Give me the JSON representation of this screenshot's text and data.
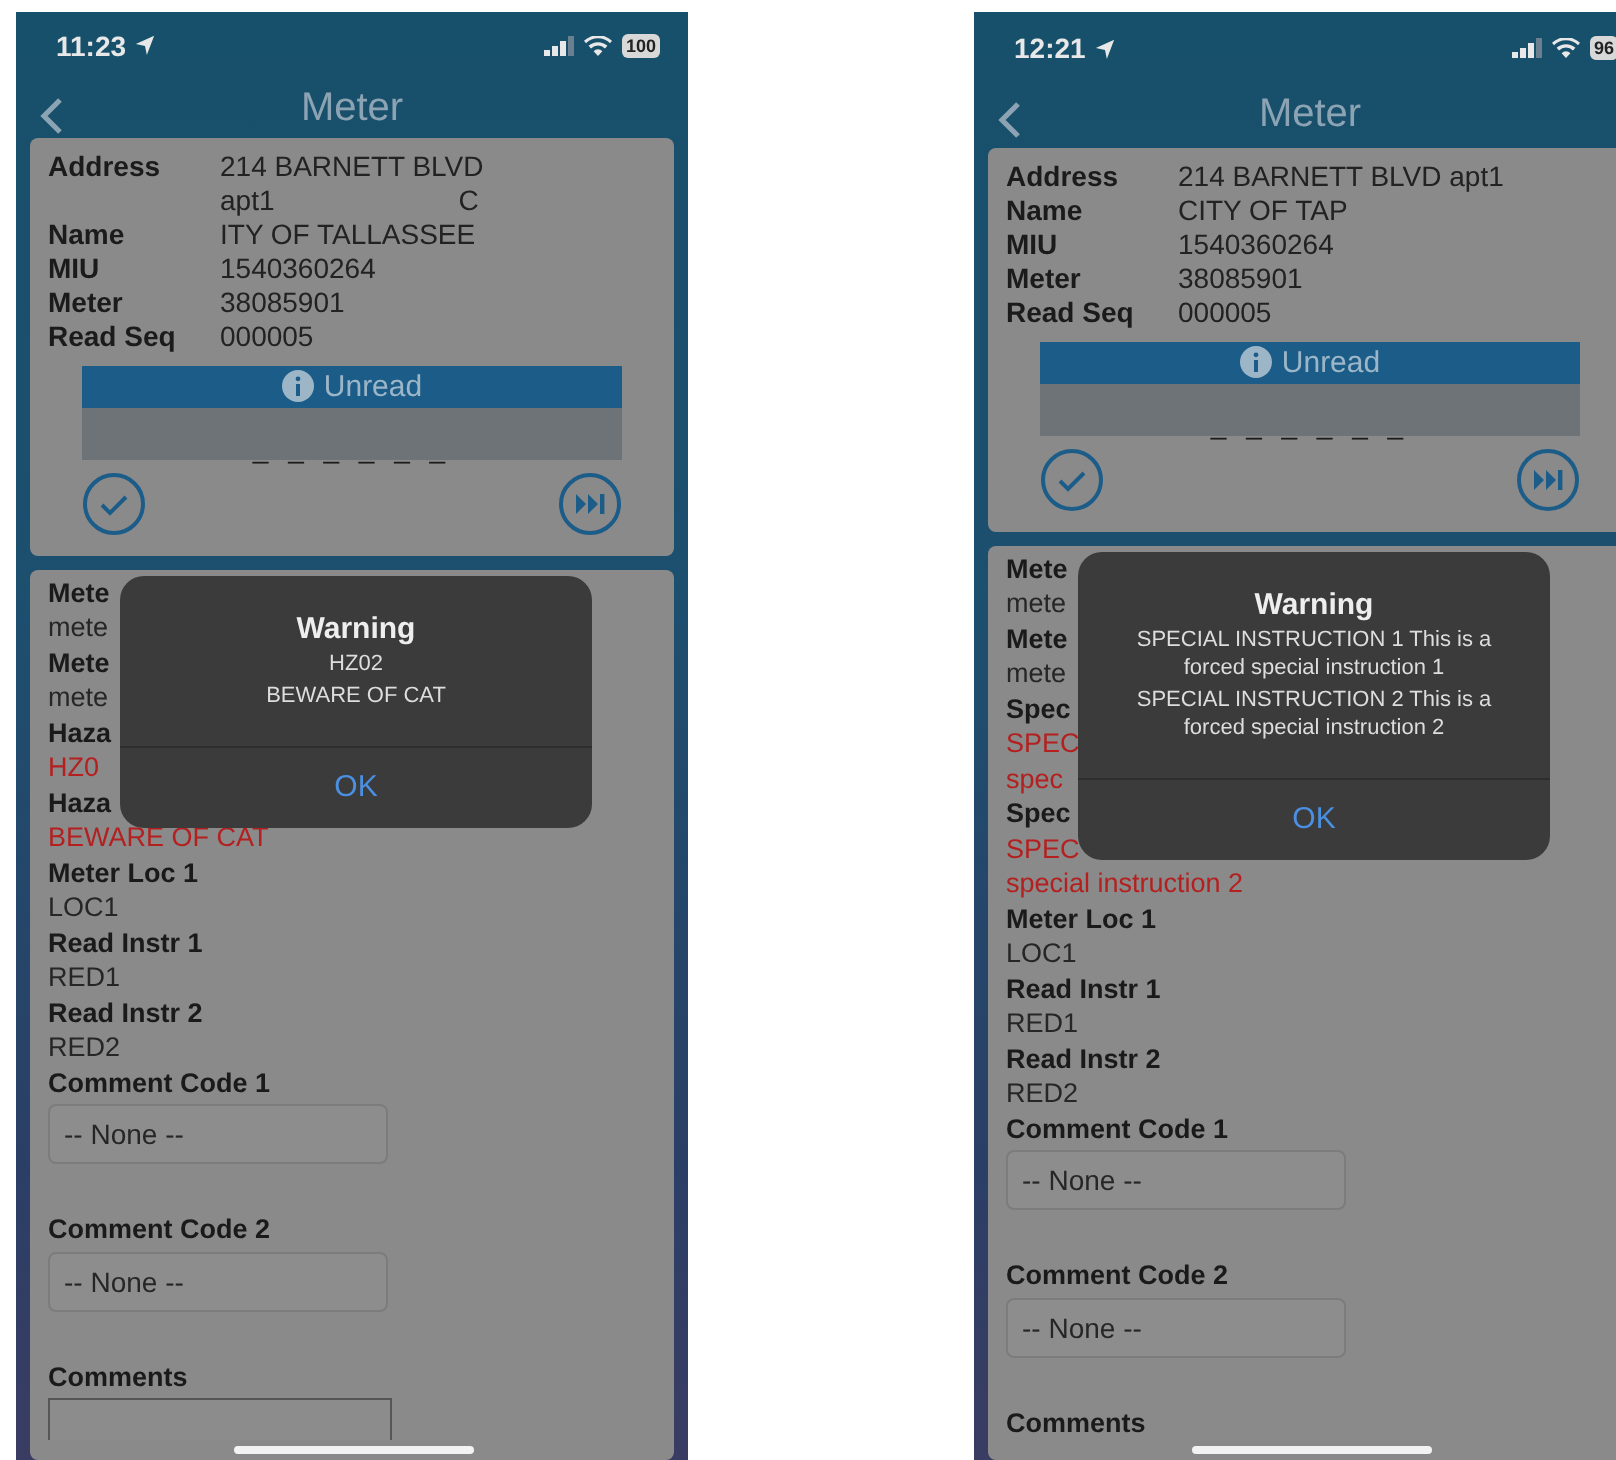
{
  "phones": [
    {
      "status": {
        "time": "11:23",
        "battery": "100"
      },
      "title": "Meter",
      "info": [
        {
          "label": "Address",
          "value": "214 BARNETT BLVD"
        },
        {
          "value": "apt1",
          "value_right": "C"
        },
        {
          "label": "Name",
          "value": "ITY OF TALLASSEE"
        },
        {
          "label": "MIU",
          "value": "1540360264"
        },
        {
          "label": "Meter",
          "value": "38085901"
        },
        {
          "label": "Read Seq",
          "value": "000005"
        }
      ],
      "read_status": "Unread",
      "reading": "_ _ _ _ _ _",
      "details": [
        {
          "kind": "label",
          "text": "Mete"
        },
        {
          "kind": "value",
          "text": "mete"
        },
        {
          "kind": "label",
          "text": "Mete"
        },
        {
          "kind": "value",
          "text": "mete"
        },
        {
          "kind": "label",
          "text": "Haza"
        },
        {
          "kind": "alert",
          "text": "HZ0"
        },
        {
          "kind": "label",
          "text": "Haza"
        },
        {
          "kind": "alert",
          "text": "BEWARE OF CAT"
        },
        {
          "kind": "label",
          "text": "Meter Loc 1"
        },
        {
          "kind": "value",
          "text": "LOC1"
        },
        {
          "kind": "label",
          "text": "Read Instr 1"
        },
        {
          "kind": "value",
          "text": "RED1"
        },
        {
          "kind": "label",
          "text": "Read Instr 2"
        },
        {
          "kind": "value",
          "text": "RED2"
        }
      ],
      "selects": [
        {
          "label": "Comment Code 1",
          "value": "-- None --"
        },
        {
          "label": "Comment Code 2",
          "value": "-- None --"
        }
      ],
      "comments": {
        "label": "Comments",
        "field_visible": true
      },
      "alert": {
        "title": "Warning",
        "lines": [
          "HZ02",
          "BEWARE OF CAT"
        ],
        "button": "OK"
      }
    },
    {
      "status": {
        "time": "12:21",
        "battery": "96"
      },
      "title": "Meter",
      "info": [
        {
          "label": "Address",
          "value": "214 BARNETT BLVD apt1"
        },
        {
          "label": "Name",
          "value": "CITY OF TAP"
        },
        {
          "label": "MIU",
          "value": "1540360264"
        },
        {
          "label": "Meter",
          "value": "38085901"
        },
        {
          "label": "Read Seq",
          "value": "000005"
        }
      ],
      "read_status": "Unread",
      "reading": "_ _ _ _ _ _",
      "details": [
        {
          "kind": "label",
          "text": "Mete"
        },
        {
          "kind": "value",
          "text": "mete"
        },
        {
          "kind": "label",
          "text": "Mete"
        },
        {
          "kind": "value",
          "text": "mete"
        },
        {
          "kind": "label",
          "text": "Spec"
        },
        {
          "kind": "alert",
          "text": "SPEC"
        },
        {
          "kind": "alert",
          "text": "spec"
        },
        {
          "kind": "label",
          "text": "Spec"
        },
        {
          "kind": "alert",
          "text": "SPEC"
        },
        {
          "kind": "alert",
          "text": "special instruction 2"
        },
        {
          "kind": "label",
          "text": "Meter Loc 1"
        },
        {
          "kind": "value",
          "text": "LOC1"
        },
        {
          "kind": "label",
          "text": "Read Instr 1"
        },
        {
          "kind": "value",
          "text": "RED1"
        },
        {
          "kind": "label",
          "text": "Read Instr 2"
        },
        {
          "kind": "value",
          "text": "RED2"
        }
      ],
      "selects": [
        {
          "label": "Comment Code 1",
          "value": "-- None --"
        },
        {
          "label": "Comment Code 2",
          "value": "-- None --"
        }
      ],
      "comments": {
        "label": "Comments",
        "field_visible": false
      },
      "alert": {
        "title": "Warning",
        "lines": [
          "SPECIAL INSTRUCTION 1 This is a forced special instruction 1",
          "SPECIAL INSTRUCTION 2 This is a forced special instruction 2"
        ],
        "button": "OK"
      }
    }
  ]
}
